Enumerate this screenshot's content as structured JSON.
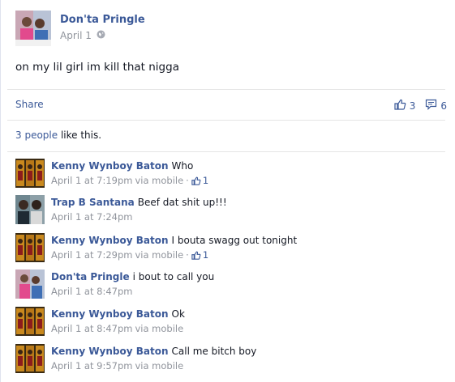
{
  "post": {
    "author": "Don'ta Pringle",
    "date": "April 1",
    "privacy_icon": "globe-icon",
    "text": "on my lil girl im kill that nigga",
    "share_label": "Share",
    "like_count": "3",
    "comment_count": "6",
    "likes_summary_count": "3 people",
    "likes_summary_suffix": " like this."
  },
  "comments": [
    {
      "author": "Kenny Wynboy Baton",
      "text": "Who",
      "time": "April 1 at 7:19pm",
      "via": "via mobile",
      "likes": "1",
      "avatar": "kenny"
    },
    {
      "author": "Trap B Santana",
      "text": "Beef dat shit up!!!",
      "time": "April 1 at 7:24pm",
      "via": "",
      "likes": "",
      "avatar": "trap"
    },
    {
      "author": "Kenny Wynboy Baton",
      "text": "I bouta swagg out tonight",
      "time": "April 1 at 7:29pm",
      "via": "via mobile",
      "likes": "1",
      "avatar": "kenny"
    },
    {
      "author": "Don'ta Pringle",
      "text": "i bout to call you",
      "time": "April 1 at 8:47pm",
      "via": "",
      "likes": "",
      "avatar": "donta"
    },
    {
      "author": "Kenny Wynboy Baton",
      "text": "Ok",
      "time": "April 1 at 8:47pm",
      "via": "via mobile",
      "likes": "",
      "avatar": "kenny"
    },
    {
      "author": "Kenny Wynboy Baton",
      "text": "Call me bitch boy",
      "time": "April 1 at 9:57pm",
      "via": "via mobile",
      "likes": "",
      "avatar": "kenny"
    }
  ],
  "colors": {
    "link": "#3b5998",
    "meta": "#90949c",
    "text": "#141823",
    "divider": "#e5e5e5"
  }
}
